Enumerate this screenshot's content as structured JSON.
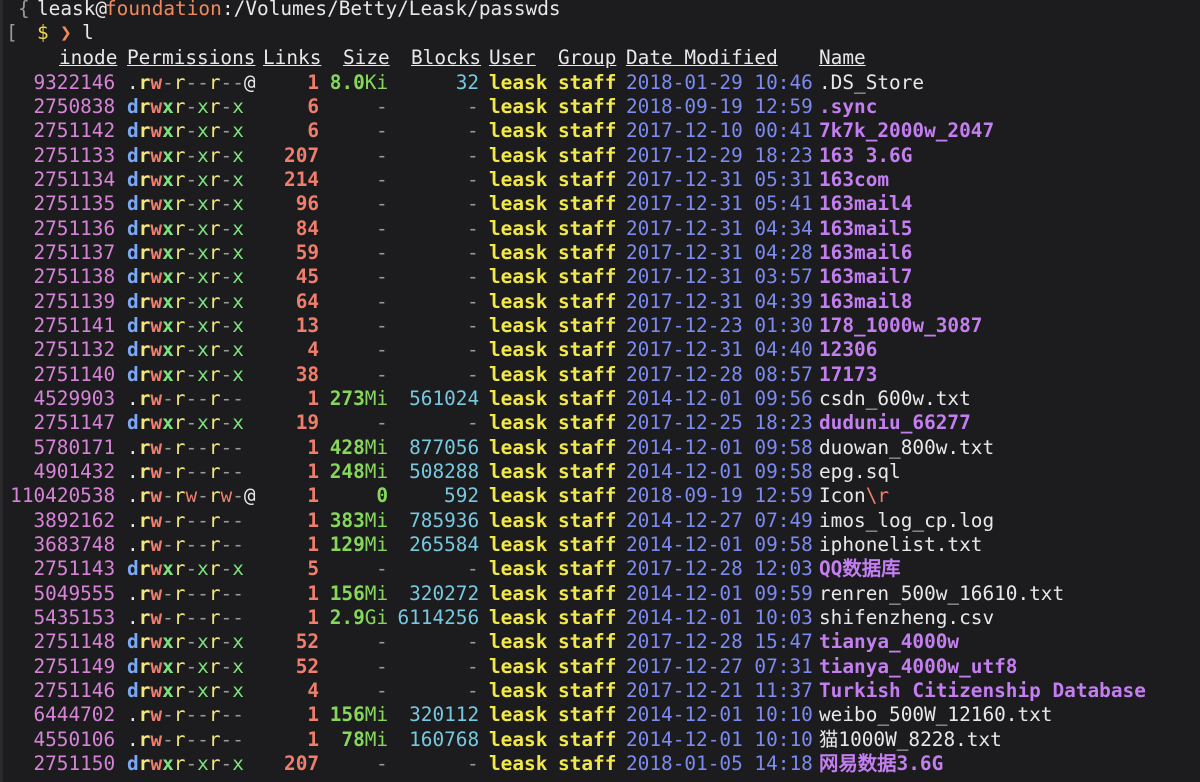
{
  "prompt": {
    "user_line_prefix": "{ ",
    "user": "leask@",
    "host": "foundation",
    "path": ":/Volumes/Betty/Leask/passwds",
    "bracket": "[",
    "dollar": "$",
    "chevron": "❯",
    "command": "l"
  },
  "headers": {
    "inode": "inode",
    "permissions": "Permissions",
    "links": "Links",
    "size": "Size",
    "blocks": "Blocks",
    "user": "User",
    "group": "Group",
    "date": "Date Modified",
    "name": "Name"
  },
  "files": [
    {
      "inode": "9322146",
      "type": ".",
      "perm": "rw-r--r--",
      "attr": "@",
      "links": "1",
      "size_num": "8.0",
      "size_unit": "Ki",
      "blocks": "32",
      "user": "leask",
      "group": "staff",
      "date": "2018-01-29 10:46",
      "name": ".DS_Store",
      "name_esc": "",
      "is_dir": false
    },
    {
      "inode": "2750838",
      "type": "d",
      "perm": "rwxr-xr-x",
      "attr": "",
      "links": "6",
      "size_num": "",
      "size_unit": "",
      "blocks": "",
      "user": "leask",
      "group": "staff",
      "date": "2018-09-19 12:59",
      "name": ".sync",
      "name_esc": "",
      "is_dir": true
    },
    {
      "inode": "2751142",
      "type": "d",
      "perm": "rwxr-xr-x",
      "attr": "",
      "links": "6",
      "size_num": "",
      "size_unit": "",
      "blocks": "",
      "user": "leask",
      "group": "staff",
      "date": "2017-12-10 00:41",
      "name": "7k7k_2000w_2047",
      "name_esc": "",
      "is_dir": true
    },
    {
      "inode": "2751133",
      "type": "d",
      "perm": "rwxr-xr-x",
      "attr": "",
      "links": "207",
      "size_num": "",
      "size_unit": "",
      "blocks": "",
      "user": "leask",
      "group": "staff",
      "date": "2017-12-29 18:23",
      "name": "163 3.6G",
      "name_esc": "",
      "is_dir": true
    },
    {
      "inode": "2751134",
      "type": "d",
      "perm": "rwxr-xr-x",
      "attr": "",
      "links": "214",
      "size_num": "",
      "size_unit": "",
      "blocks": "",
      "user": "leask",
      "group": "staff",
      "date": "2017-12-31 05:31",
      "name": "163com",
      "name_esc": "",
      "is_dir": true
    },
    {
      "inode": "2751135",
      "type": "d",
      "perm": "rwxr-xr-x",
      "attr": "",
      "links": "96",
      "size_num": "",
      "size_unit": "",
      "blocks": "",
      "user": "leask",
      "group": "staff",
      "date": "2017-12-31 05:41",
      "name": "163mail4",
      "name_esc": "",
      "is_dir": true
    },
    {
      "inode": "2751136",
      "type": "d",
      "perm": "rwxr-xr-x",
      "attr": "",
      "links": "84",
      "size_num": "",
      "size_unit": "",
      "blocks": "",
      "user": "leask",
      "group": "staff",
      "date": "2017-12-31 04:34",
      "name": "163mail5",
      "name_esc": "",
      "is_dir": true
    },
    {
      "inode": "2751137",
      "type": "d",
      "perm": "rwxr-xr-x",
      "attr": "",
      "links": "59",
      "size_num": "",
      "size_unit": "",
      "blocks": "",
      "user": "leask",
      "group": "staff",
      "date": "2017-12-31 04:28",
      "name": "163mail6",
      "name_esc": "",
      "is_dir": true
    },
    {
      "inode": "2751138",
      "type": "d",
      "perm": "rwxr-xr-x",
      "attr": "",
      "links": "45",
      "size_num": "",
      "size_unit": "",
      "blocks": "",
      "user": "leask",
      "group": "staff",
      "date": "2017-12-31 03:57",
      "name": "163mail7",
      "name_esc": "",
      "is_dir": true
    },
    {
      "inode": "2751139",
      "type": "d",
      "perm": "rwxr-xr-x",
      "attr": "",
      "links": "64",
      "size_num": "",
      "size_unit": "",
      "blocks": "",
      "user": "leask",
      "group": "staff",
      "date": "2017-12-31 04:39",
      "name": "163mail8",
      "name_esc": "",
      "is_dir": true
    },
    {
      "inode": "2751141",
      "type": "d",
      "perm": "rwxr-xr-x",
      "attr": "",
      "links": "13",
      "size_num": "",
      "size_unit": "",
      "blocks": "",
      "user": "leask",
      "group": "staff",
      "date": "2017-12-23 01:30",
      "name": "178_1000w_3087",
      "name_esc": "",
      "is_dir": true
    },
    {
      "inode": "2751132",
      "type": "d",
      "perm": "rwxr-xr-x",
      "attr": "",
      "links": "4",
      "size_num": "",
      "size_unit": "",
      "blocks": "",
      "user": "leask",
      "group": "staff",
      "date": "2017-12-31 04:40",
      "name": "12306",
      "name_esc": "",
      "is_dir": true
    },
    {
      "inode": "2751140",
      "type": "d",
      "perm": "rwxr-xr-x",
      "attr": "",
      "links": "38",
      "size_num": "",
      "size_unit": "",
      "blocks": "",
      "user": "leask",
      "group": "staff",
      "date": "2017-12-28 08:57",
      "name": "17173",
      "name_esc": "",
      "is_dir": true
    },
    {
      "inode": "4529903",
      "type": ".",
      "perm": "rw-r--r--",
      "attr": "",
      "links": "1",
      "size_num": "273",
      "size_unit": "Mi",
      "blocks": "561024",
      "user": "leask",
      "group": "staff",
      "date": "2014-12-01 09:56",
      "name": "csdn_600w.txt",
      "name_esc": "",
      "is_dir": false
    },
    {
      "inode": "2751147",
      "type": "d",
      "perm": "rwxr-xr-x",
      "attr": "",
      "links": "19",
      "size_num": "",
      "size_unit": "",
      "blocks": "",
      "user": "leask",
      "group": "staff",
      "date": "2017-12-25 18:23",
      "name": "duduniu_66277",
      "name_esc": "",
      "is_dir": true
    },
    {
      "inode": "5780171",
      "type": ".",
      "perm": "rw-r--r--",
      "attr": "",
      "links": "1",
      "size_num": "428",
      "size_unit": "Mi",
      "blocks": "877056",
      "user": "leask",
      "group": "staff",
      "date": "2014-12-01 09:58",
      "name": "duowan_800w.txt",
      "name_esc": "",
      "is_dir": false
    },
    {
      "inode": "4901432",
      "type": ".",
      "perm": "rw-r--r--",
      "attr": "",
      "links": "1",
      "size_num": "248",
      "size_unit": "Mi",
      "blocks": "508288",
      "user": "leask",
      "group": "staff",
      "date": "2014-12-01 09:58",
      "name": "epg.sql",
      "name_esc": "",
      "is_dir": false
    },
    {
      "inode": "110420538",
      "type": ".",
      "perm": "rw-rw-rw-",
      "attr": "@",
      "links": "1",
      "size_num": "0",
      "size_unit": "",
      "blocks": "592",
      "user": "leask",
      "group": "staff",
      "date": "2018-09-19 12:59",
      "name": "Icon",
      "name_esc": "\\r",
      "is_dir": false
    },
    {
      "inode": "3892162",
      "type": ".",
      "perm": "rw-r--r--",
      "attr": "",
      "links": "1",
      "size_num": "383",
      "size_unit": "Mi",
      "blocks": "785936",
      "user": "leask",
      "group": "staff",
      "date": "2014-12-27 07:49",
      "name": "imos_log_cp.log",
      "name_esc": "",
      "is_dir": false
    },
    {
      "inode": "3683748",
      "type": ".",
      "perm": "rw-r--r--",
      "attr": "",
      "links": "1",
      "size_num": "129",
      "size_unit": "Mi",
      "blocks": "265584",
      "user": "leask",
      "group": "staff",
      "date": "2014-12-01 09:58",
      "name": "iphonelist.txt",
      "name_esc": "",
      "is_dir": false
    },
    {
      "inode": "2751143",
      "type": "d",
      "perm": "rwxr-xr-x",
      "attr": "",
      "links": "5",
      "size_num": "",
      "size_unit": "",
      "blocks": "",
      "user": "leask",
      "group": "staff",
      "date": "2017-12-28 12:03",
      "name": "QQ数据库",
      "name_esc": "",
      "is_dir": true
    },
    {
      "inode": "5049555",
      "type": ".",
      "perm": "rw-r--r--",
      "attr": "",
      "links": "1",
      "size_num": "156",
      "size_unit": "Mi",
      "blocks": "320272",
      "user": "leask",
      "group": "staff",
      "date": "2014-12-01 09:59",
      "name": "renren_500w_16610.txt",
      "name_esc": "",
      "is_dir": false
    },
    {
      "inode": "5435153",
      "type": ".",
      "perm": "rw-r--r--",
      "attr": "",
      "links": "1",
      "size_num": "2.9",
      "size_unit": "Gi",
      "blocks": "6114256",
      "user": "leask",
      "group": "staff",
      "date": "2014-12-01 10:03",
      "name": "shifenzheng.csv",
      "name_esc": "",
      "is_dir": false
    },
    {
      "inode": "2751148",
      "type": "d",
      "perm": "rwxr-xr-x",
      "attr": "",
      "links": "52",
      "size_num": "",
      "size_unit": "",
      "blocks": "",
      "user": "leask",
      "group": "staff",
      "date": "2017-12-28 15:47",
      "name": "tianya_4000w",
      "name_esc": "",
      "is_dir": true
    },
    {
      "inode": "2751149",
      "type": "d",
      "perm": "rwxr-xr-x",
      "attr": "",
      "links": "52",
      "size_num": "",
      "size_unit": "",
      "blocks": "",
      "user": "leask",
      "group": "staff",
      "date": "2017-12-27 07:31",
      "name": "tianya_4000w_utf8",
      "name_esc": "",
      "is_dir": true
    },
    {
      "inode": "2751146",
      "type": "d",
      "perm": "rwxr-xr-x",
      "attr": "",
      "links": "4",
      "size_num": "",
      "size_unit": "",
      "blocks": "",
      "user": "leask",
      "group": "staff",
      "date": "2017-12-21 11:37",
      "name": "Turkish Citizenship Database",
      "name_esc": "",
      "is_dir": true
    },
    {
      "inode": "6444702",
      "type": ".",
      "perm": "rw-r--r--",
      "attr": "",
      "links": "1",
      "size_num": "156",
      "size_unit": "Mi",
      "blocks": "320112",
      "user": "leask",
      "group": "staff",
      "date": "2014-12-01 10:10",
      "name": "weibo_500W_12160.txt",
      "name_esc": "",
      "is_dir": false
    },
    {
      "inode": "4550106",
      "type": ".",
      "perm": "rw-r--r--",
      "attr": "",
      "links": "1",
      "size_num": "78",
      "size_unit": "Mi",
      "blocks": "160768",
      "user": "leask",
      "group": "staff",
      "date": "2014-12-01 10:10",
      "name": "猫1000W_8228.txt",
      "name_esc": "",
      "is_dir": false
    },
    {
      "inode": "2751150",
      "type": "d",
      "perm": "rwxr-xr-x",
      "attr": "",
      "links": "207",
      "size_num": "",
      "size_unit": "",
      "blocks": "",
      "user": "leask",
      "group": "staff",
      "date": "2018-01-05 14:18",
      "name": "网易数据3.6G",
      "name_esc": "",
      "is_dir": true
    }
  ],
  "placeholders": {
    "dash": "-"
  }
}
